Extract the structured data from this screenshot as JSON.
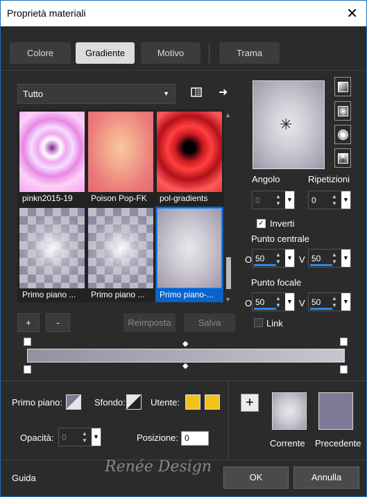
{
  "window": {
    "title": "Proprietà materiali",
    "close_glyph": "✕"
  },
  "tabs": [
    {
      "label": "Colore",
      "active": false
    },
    {
      "label": "Gradiente",
      "active": true
    },
    {
      "label": "Motivo",
      "active": false
    },
    {
      "label": "Trama",
      "active": false
    }
  ],
  "library": {
    "category": "Tutto",
    "icons": [
      "library-icon",
      "arrow-right-icon"
    ],
    "items": [
      {
        "label": "pinkn2015-19",
        "selected": false
      },
      {
        "label": "Poison Pop-FK",
        "selected": false
      },
      {
        "label": "pol-gradients",
        "selected": false
      },
      {
        "label": "Primo piano ...",
        "selected": false
      },
      {
        "label": "Primo piano ...",
        "selected": false
      },
      {
        "label": "Primo piano-...",
        "selected": true
      }
    ],
    "buttons": {
      "add": "+",
      "remove": "-",
      "reset": "Reimposta",
      "save": "Salva"
    }
  },
  "gradient": {
    "angle_label": "Angolo",
    "angle_value": "0",
    "repeats_label": "Ripetizioni",
    "repeats_value": "0",
    "invert_label": "Inverti",
    "invert_checked": true,
    "center_label": "Punto centrale",
    "center_o": "50",
    "center_v": "50",
    "focal_label": "Punto focale",
    "focal_o": "50",
    "focal_v": "50",
    "link_label": "Link",
    "link_checked": false,
    "o_label": "O",
    "v_label": "V",
    "types": [
      "linear-icon",
      "rectangular-icon",
      "sunburst-icon",
      "radial-icon"
    ],
    "bar_colors": [
      "#9390a2",
      "#c8c6cf"
    ]
  },
  "editor": {
    "fg_label": "Primo piano:",
    "bg_label": "Sfondo:",
    "user_label": "Utente:",
    "user_color": "#f2c21c",
    "opacity_label": "Opacità:",
    "opacity_value": "0",
    "position_label": "Posizione:",
    "position_value": "0"
  },
  "current": {
    "label": "Corrente"
  },
  "previous": {
    "label": "Precedente",
    "color": "#7e7a96"
  },
  "footer": {
    "help": "Guida",
    "ok": "OK",
    "cancel": "Annulla",
    "watermark": "Renée Design"
  }
}
